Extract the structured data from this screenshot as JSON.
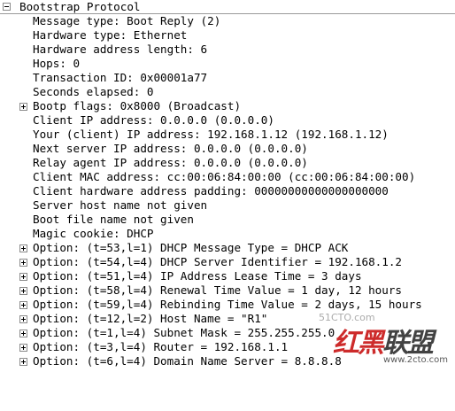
{
  "tree": {
    "root_label": "Bootstrap Protocol",
    "fields": [
      "Message type: Boot Reply (2)",
      "Hardware type: Ethernet",
      "Hardware address length: 6",
      "Hops: 0",
      "Transaction ID: 0x00001a77",
      "Seconds elapsed: 0"
    ],
    "bootp_flags": "Bootp flags: 0x8000 (Broadcast)",
    "address_fields": [
      "Client IP address: 0.0.0.0 (0.0.0.0)",
      "Your (client) IP address: 192.168.1.12 (192.168.1.12)",
      "Next server IP address: 0.0.0.0 (0.0.0.0)",
      "Relay agent IP address: 0.0.0.0 (0.0.0.0)",
      "Client MAC address: cc:00:06:84:00:00 (cc:00:06:84:00:00)",
      "Client hardware address padding: 00000000000000000000",
      "Server host name not given",
      "Boot file name not given",
      "Magic cookie: DHCP"
    ],
    "options": [
      "Option: (t=53,l=1) DHCP Message Type = DHCP ACK",
      "Option: (t=54,l=4) DHCP Server Identifier = 192.168.1.2",
      "Option: (t=51,l=4) IP Address Lease Time = 3 days",
      "Option: (t=58,l=4) Renewal Time Value = 1 day, 12 hours",
      "Option: (t=59,l=4) Rebinding Time Value = 2 days, 15 hours",
      "Option: (t=12,l=2) Host Name = \"R1\"",
      "Option: (t=1,l=4) Subnet Mask = 255.255.255.0",
      "Option: (t=3,l=4) Router = 192.168.1.1",
      "Option: (t=6,l=4) Domain Name Server = 8.8.8.8"
    ]
  },
  "watermark": {
    "site_text": "51CTO.com",
    "logo_part1": "红黑",
    "logo_part2": "联盟",
    "url": "www.2cto.com"
  }
}
